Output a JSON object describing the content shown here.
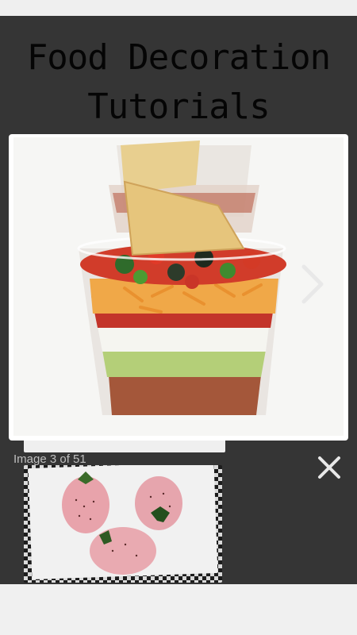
{
  "app": {
    "title": "Food Decoration Tutorials"
  },
  "viewer": {
    "counter": "Image 3 of 51",
    "next_icon": "chevron-right-icon",
    "close_icon": "close-icon"
  },
  "colors": {
    "app_background": "#353535",
    "title_text": "#050505",
    "counter_text": "#bfbfbf",
    "control_icon": "#e8e8e8"
  }
}
